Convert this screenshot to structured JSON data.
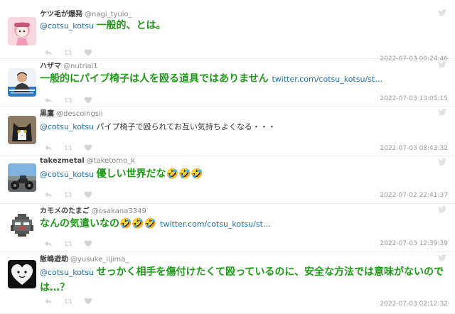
{
  "colors": {
    "mention": "#1b6fb5",
    "emphasis": "#1e9a17",
    "meta": "#999999",
    "icon": "#d4d4d4"
  },
  "icons": {
    "reply": "reply-icon",
    "retweet": "retweet-icon",
    "like": "heart-icon",
    "brand": "twitter-bird-icon"
  },
  "tweets": [
    {
      "user": "ケツ毛が爆発",
      "handle": "@nagi_tyuio_",
      "avatar": "anime-character-avatar",
      "parts": [
        {
          "text": "@cotsu_kotsu ",
          "style": "mention"
        },
        {
          "text": "一般的、とは。",
          "style": "em"
        }
      ],
      "time": "2022-07-03 00:24:46"
    },
    {
      "user": "ハザマ",
      "handle": "@nutrial1",
      "avatar": "presenter-photo-avatar",
      "parts": [
        {
          "text": "一般的にパイプ椅子は人を殴る道具ではありません ",
          "style": "em"
        },
        {
          "text": "twitter.com/cotsu_kotsu/st…",
          "style": "link"
        }
      ],
      "time": "2022-07-03 13:05:15"
    },
    {
      "user": "黒鷹",
      "handle": "@descoingsii",
      "avatar": "cat-photo-avatar",
      "parts": [
        {
          "text": "@cotsu_kotsu ",
          "style": "mention"
        },
        {
          "text": "パイプ椅子で殴られてお互い気持ちよくなる・・・",
          "style": "norm"
        }
      ],
      "time": "2022-07-03 08:43:32"
    },
    {
      "user": "takezmetal",
      "handle": "@taketomo_k",
      "avatar": "motorcycle-photo-avatar",
      "parts": [
        {
          "text": "@cotsu_kotsu ",
          "style": "mention"
        },
        {
          "text": "優しい世界だな🤣🤣🤣",
          "style": "em"
        }
      ],
      "time": "2022-07-02 22:41:37"
    },
    {
      "user": "カモメのたまご",
      "handle": "@osakana3349",
      "avatar": "pixel-bird-avatar",
      "parts": [
        {
          "text": "なんの気遣いなの🤣🤣🤣 ",
          "style": "em"
        },
        {
          "text": "twitter.com/cotsu_kotsu/st…",
          "style": "link"
        }
      ],
      "time": "2022-07-03 12:39:39"
    },
    {
      "user": "飯嶋遊助",
      "handle": "@yusuke_iijima_",
      "avatar": "heart-face-avatar",
      "parts": [
        {
          "text": "@cotsu_kotsu ",
          "style": "mention"
        },
        {
          "text": "せっかく相手を傷付けたくて殴っているのに、安全な方法では意味がないのでは…？",
          "style": "em"
        }
      ],
      "time": "2022-07-03 02:12:32"
    }
  ]
}
